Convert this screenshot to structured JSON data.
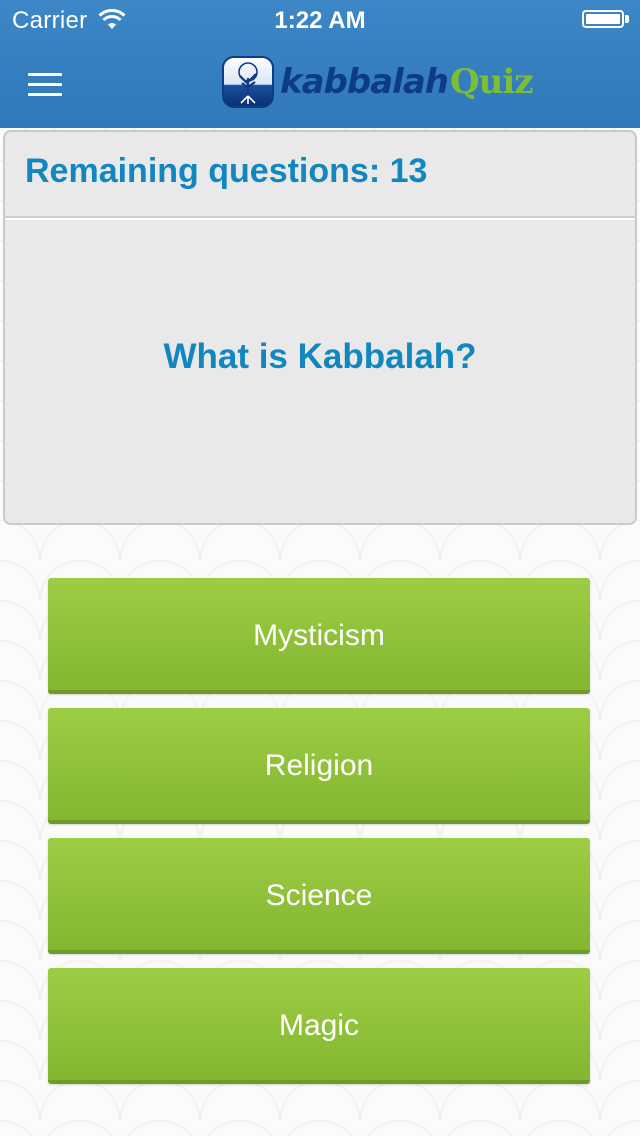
{
  "status_bar": {
    "carrier": "Carrier",
    "time": "1:22 AM",
    "battery_level": 1.0
  },
  "nav": {
    "menu_icon": "hamburger-menu-icon",
    "logo": {
      "text_primary": "kabbalah",
      "text_secondary": "Quiz",
      "icon": "tree-logo-icon"
    }
  },
  "quiz": {
    "remaining_label": "Remaining questions: 13",
    "question": "What is Kabbalah?",
    "answers": [
      {
        "label": "Mysticism"
      },
      {
        "label": "Religion"
      },
      {
        "label": "Science"
      },
      {
        "label": "Magic"
      }
    ]
  },
  "colors": {
    "nav_bar": "#3381c2",
    "accent_text": "#1286bf",
    "answer_button": "#8dc13a",
    "logo_dark": "#0d3c86",
    "logo_green": "#7ebd36"
  }
}
